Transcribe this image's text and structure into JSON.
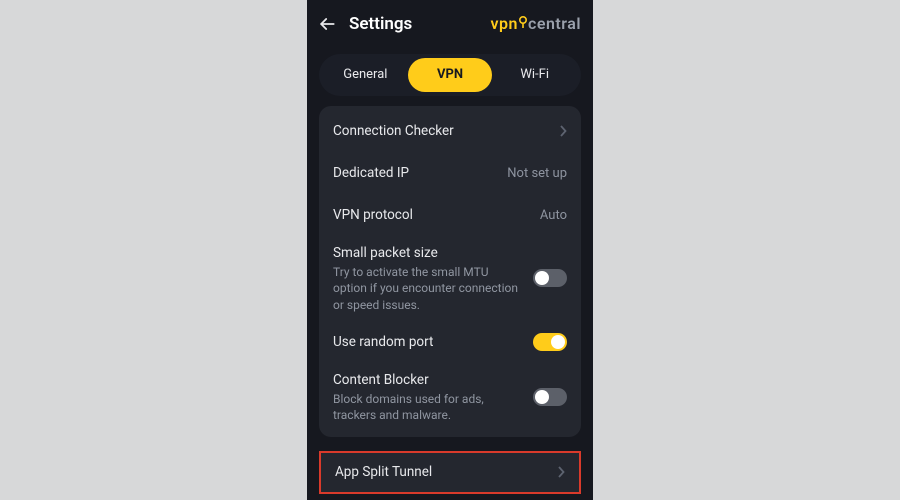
{
  "header": {
    "title": "Settings",
    "brand_part1": "vpn",
    "brand_part2": "central"
  },
  "tabs": [
    {
      "label": "General",
      "active": false
    },
    {
      "label": "VPN",
      "active": true
    },
    {
      "label": "Wi-Fi",
      "active": false
    }
  ],
  "settings": {
    "connection_checker": {
      "title": "Connection Checker"
    },
    "dedicated_ip": {
      "title": "Dedicated IP",
      "value": "Not set up"
    },
    "vpn_protocol": {
      "title": "VPN protocol",
      "value": "Auto"
    },
    "small_packet": {
      "title": "Small packet size",
      "desc": "Try to activate the small MTU option if you encounter connection or speed issues.",
      "on": false
    },
    "random_port": {
      "title": "Use random port",
      "on": true
    },
    "content_blocker": {
      "title": "Content Blocker",
      "desc": "Block domains used for ads, trackers and malware.",
      "on": false
    },
    "split_tunnel": {
      "title": "App Split Tunnel"
    }
  }
}
